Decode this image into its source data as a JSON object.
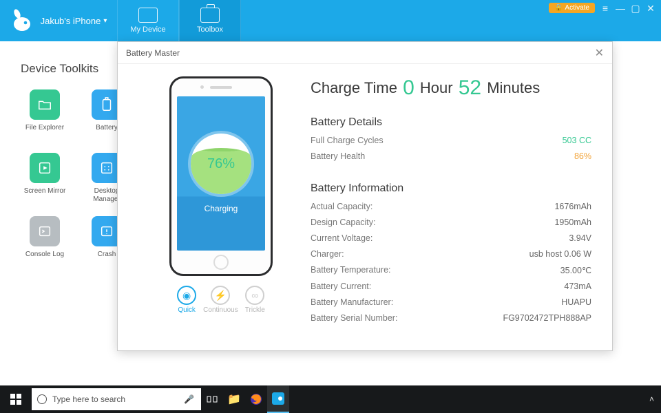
{
  "header": {
    "device_label": "Jakub's iPhone",
    "tabs": {
      "my_device": "My Device",
      "toolbox": "Toolbox"
    },
    "activate": "Activate"
  },
  "toolkits": {
    "title": "Device Toolkits",
    "items": [
      {
        "label": "File Explorer"
      },
      {
        "label": "Battery"
      },
      {
        "label": "Screen Mirror"
      },
      {
        "label": "Desktop Manager"
      },
      {
        "label": "Console Log"
      },
      {
        "label": "Crash"
      }
    ]
  },
  "modal": {
    "title": "Battery Master",
    "phone": {
      "percent": "76%",
      "status": "Charging"
    },
    "modes": {
      "quick": "Quick",
      "continuous": "Continuous",
      "trickle": "Trickle"
    },
    "charge_time": {
      "label_prefix": "Charge Time",
      "hours": "0",
      "hours_unit": "Hour",
      "minutes": "52",
      "minutes_unit": "Minutes"
    },
    "details_heading": "Battery Details",
    "details": {
      "cycles_k": "Full Charge Cycles",
      "cycles_v": "503 CC",
      "health_k": "Battery Health",
      "health_v": "86%"
    },
    "info_heading": "Battery Information",
    "info": {
      "actual_k": "Actual Capacity:",
      "actual_v": "1676mAh",
      "design_k": "Design Capacity:",
      "design_v": "1950mAh",
      "voltage_k": "Current Voltage:",
      "voltage_v": "3.94V",
      "charger_k": "Charger:",
      "charger_v": "usb host 0.06 W",
      "temp_k": "Battery Temperature:",
      "temp_v": "35.00℃",
      "current_k": "Battery Current:",
      "current_v": "473mA",
      "manuf_k": "Battery Manufacturer:",
      "manuf_v": "HUAPU",
      "serial_k": "Battery Serial Number:",
      "serial_v": "FG9702472TPH888AP"
    }
  },
  "taskbar": {
    "search_placeholder": "Type here to search"
  }
}
